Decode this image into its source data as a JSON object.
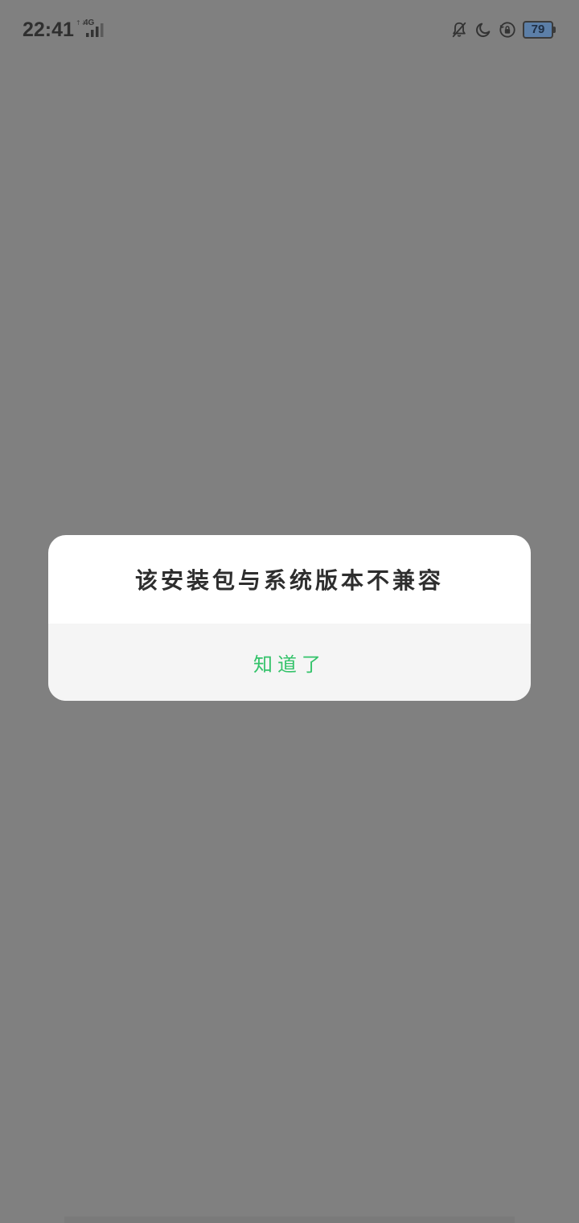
{
  "status_bar": {
    "time": "22:41",
    "network": "4G",
    "network_sub": "↑↓",
    "battery": "79",
    "icons": [
      "mute-bell-icon",
      "moon-icon",
      "rotation-lock-icon",
      "battery-icon"
    ]
  },
  "dialog": {
    "message": "该安装包与系统版本不兼容",
    "button_label": "知道了"
  },
  "colors": {
    "overlay": "#808080",
    "accent": "#34c36a",
    "battery_fill": "#5c7fa8"
  }
}
